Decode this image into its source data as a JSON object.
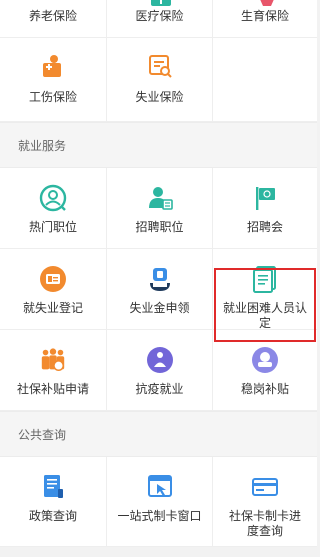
{
  "insurance": {
    "items": [
      {
        "label": "养老保险",
        "icon": "pension-icon"
      },
      {
        "label": "医疗保险",
        "icon": "medical-icon"
      },
      {
        "label": "生育保险",
        "icon": "maternity-icon"
      },
      {
        "label": "工伤保险",
        "icon": "injury-icon"
      },
      {
        "label": "失业保险",
        "icon": "unemployment-icon"
      }
    ]
  },
  "employment": {
    "title": "就业服务",
    "items": [
      {
        "label": "热门职位",
        "icon": "person-search-icon"
      },
      {
        "label": "招聘职位",
        "icon": "recruit-person-icon"
      },
      {
        "label": "招聘会",
        "icon": "flag-icon"
      },
      {
        "label": "就失业登记",
        "icon": "id-card-icon"
      },
      {
        "label": "失业金申领",
        "icon": "hand-coin-icon"
      },
      {
        "label": "就业困难人员认定",
        "icon": "document-icon"
      },
      {
        "label": "社保补贴申请",
        "icon": "people-group-icon"
      },
      {
        "label": "抗疫就业",
        "icon": "fight-icon"
      },
      {
        "label": "稳岗补贴",
        "icon": "stable-job-icon"
      }
    ]
  },
  "public_query": {
    "title": "公共查询",
    "items": [
      {
        "label": "政策查询",
        "icon": "policy-doc-icon"
      },
      {
        "label": "一站式制卡窗口",
        "icon": "window-cursor-icon"
      },
      {
        "label": "社保卡制卡进度查询",
        "icon": "card-icon"
      }
    ]
  },
  "colors": {
    "accent_orange": "#f28a2e",
    "accent_green": "#2cb6a0",
    "accent_blue": "#3a8ee6",
    "accent_purple": "#7266d8",
    "highlight_red": "#e02a2a"
  }
}
